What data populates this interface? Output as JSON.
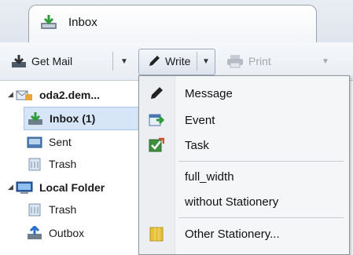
{
  "tab": {
    "label": "Inbox",
    "icon": "inbox-tray-icon"
  },
  "toolbar": {
    "get_mail": "Get Mail",
    "write": "Write",
    "print": "Print"
  },
  "folders": [
    {
      "label": "oda2.dem...",
      "icon": "account-icon",
      "bold": true
    },
    {
      "label": "Inbox (1)",
      "icon": "inbox-icon",
      "bold": true,
      "selected": true
    },
    {
      "label": "Sent",
      "icon": "sent-icon"
    },
    {
      "label": "Trash",
      "icon": "trash-icon"
    },
    {
      "label": "Local Folder",
      "icon": "local-folders-icon",
      "bold": true
    },
    {
      "label": "Trash",
      "icon": "trash-icon"
    },
    {
      "label": "Outbox",
      "icon": "outbox-icon"
    }
  ],
  "write_menu": {
    "items": [
      {
        "label": "Message",
        "icon": "pencil-icon"
      },
      {
        "label": "Event",
        "icon": "event-icon"
      },
      {
        "label": "Task",
        "icon": "task-icon"
      },
      {
        "label": "full_width"
      },
      {
        "label": "without Stationery"
      },
      {
        "label": "Other Stationery...",
        "icon": "stationery-icon"
      }
    ]
  },
  "colors": {
    "accent": "#3c8f3c",
    "selected_bg": "#d6e6f8",
    "menu_border": "#8e949c"
  }
}
